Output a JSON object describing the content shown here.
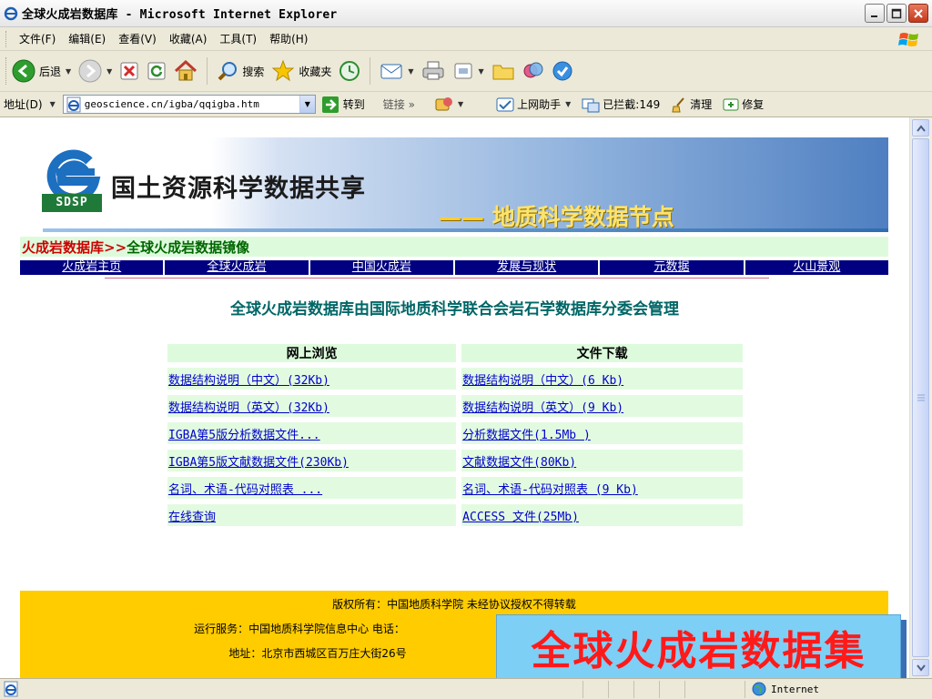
{
  "window": {
    "title": "全球火成岩数据库 - Microsoft Internet Explorer"
  },
  "menu": {
    "items": [
      "文件(F)",
      "编辑(E)",
      "查看(V)",
      "收藏(A)",
      "工具(T)",
      "帮助(H)"
    ]
  },
  "toolbar": {
    "back_label": "后退",
    "search_label": "搜索",
    "favorites_label": "收藏夹"
  },
  "address": {
    "label": "地址(D)",
    "url": "geoscience.cn/igba/qqigba.htm",
    "go_label": "转到",
    "links_label": "链接",
    "assistant_label": "上网助手",
    "blocked_label": "已拦截:149",
    "clean_label": "清理",
    "repair_label": "修复"
  },
  "banner": {
    "name": "国土资源科学数据共享",
    "sub_dash": "——",
    "subtitle": "地质科学数据节点",
    "logo_text": "SDSP"
  },
  "breadcrumb": {
    "part1": "火成岩数据库>>",
    "part2": "全球火成岩数据镜像"
  },
  "nav": {
    "items": [
      "火成岩主页",
      "全球火成岩",
      "中国火成岩",
      "发展与现状",
      "元数据",
      "火山景观"
    ]
  },
  "management_text": "全球火成岩数据库由国际地质科学联合会岩石学数据库分委会管理",
  "table": {
    "headers": [
      "网上浏览",
      "文件下载"
    ],
    "rows": [
      [
        "数据结构说明（中文）(32Kb)",
        "数据结构说明（中文）(6 Kb)"
      ],
      [
        "数据结构说明（英文）(32Kb)",
        "数据结构说明（英文）(9 Kb)"
      ],
      [
        "IGBA第5版分析数据文件...",
        "分析数据文件(1.5Mb )"
      ],
      [
        "IGBA第5版文献数据文件(230Kb)",
        "文献数据文件(80Kb)"
      ],
      [
        "名词、术语-代码对照表 ...",
        "名词、术语-代码对照表 (9 Kb)"
      ],
      [
        "在线查询",
        "ACCESS 文件(25Mb)"
      ]
    ]
  },
  "footer": {
    "line1": "版权所有：中国地质科学院    未经协议授权不得转载",
    "line2": "运行服务：中国地质科学院信息中心  电话：",
    "line3": "地址：北京市西城区百万庄大街26号"
  },
  "overlay_title": "全球火成岩数据集",
  "status": {
    "zone": "Internet"
  },
  "colors": {
    "breadcrumb_red": "#cc0000",
    "breadcrumb_green": "#006600",
    "nav_bg": "#000080",
    "footer_bg": "#ffcc00",
    "overlay_bg": "#7dcff5",
    "overlay_text": "#ff1a1a"
  }
}
